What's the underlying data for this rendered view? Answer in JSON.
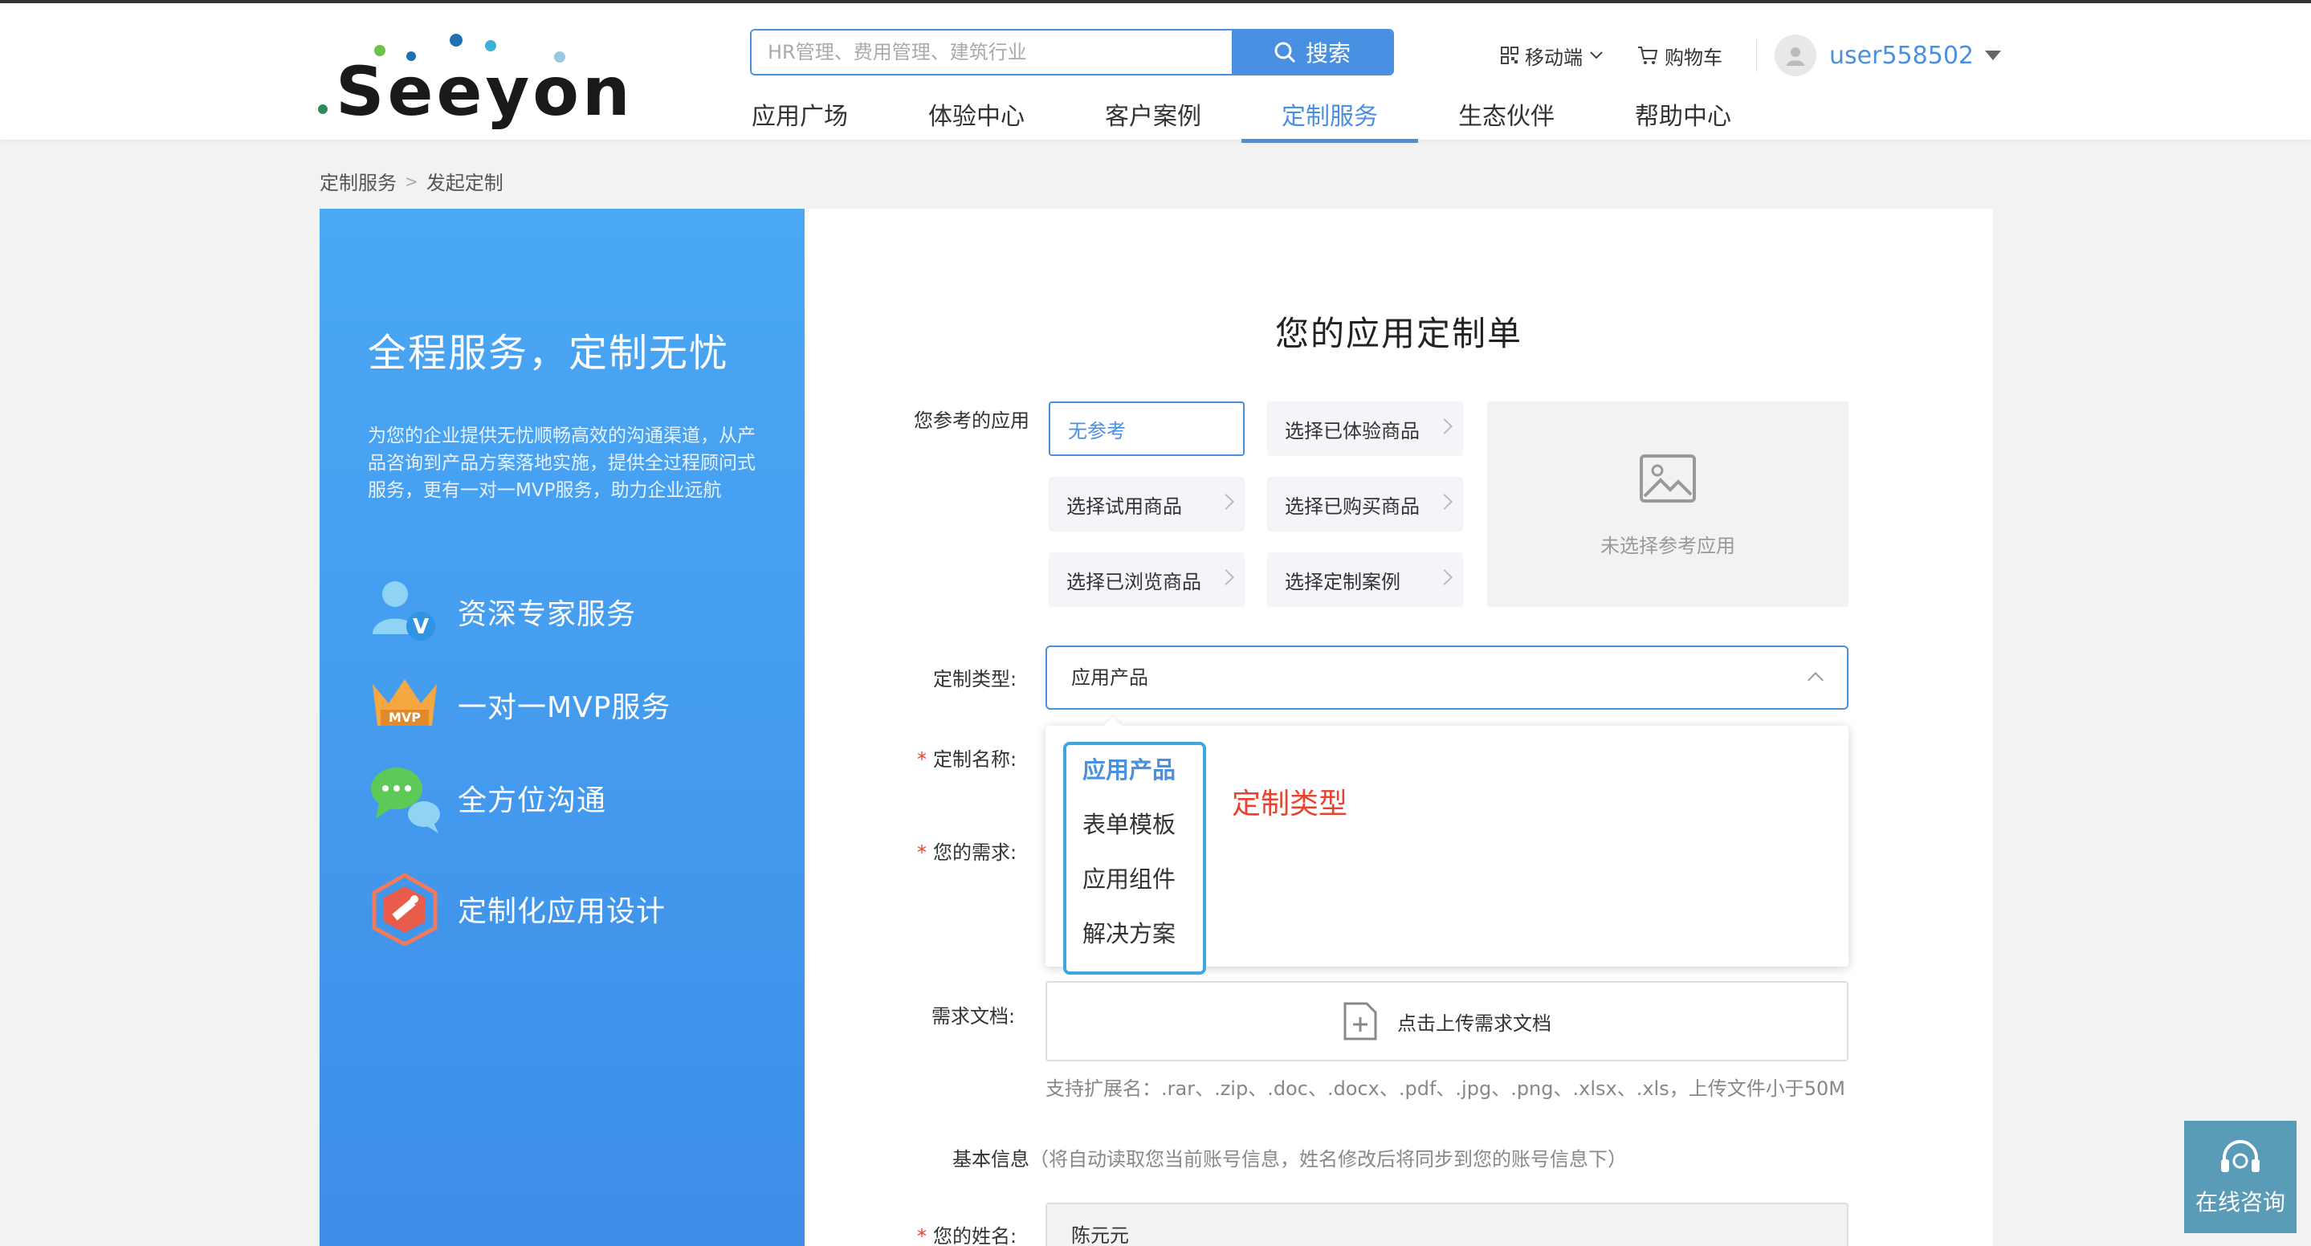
{
  "header": {
    "logo_text": "Seeyon",
    "search": {
      "placeholder": "HR管理、费用管理、建筑行业",
      "button_label": "搜索"
    },
    "nav": [
      "应用广场",
      "体验中心",
      "客户案例",
      "定制服务",
      "生态伙伴",
      "帮助中心"
    ],
    "nav_active": "定制服务",
    "mobile_label": "移动端",
    "cart_label": "购物车",
    "username": "user558502"
  },
  "breadcrumb": {
    "parent": "定制服务",
    "separator": ">",
    "current": "发起定制"
  },
  "left_panel": {
    "title": "全程服务，定制无忧",
    "description": "为您的企业提供无忧顺畅高效的沟通渠道，从产品咨询到产品方案落地实施，提供全过程顾问式服务，更有一对一MVP服务，助力企业远航",
    "features": [
      {
        "icon": "expert-icon",
        "label": "资深专家服务"
      },
      {
        "icon": "mvp-crown-icon",
        "label": "一对一MVP服务"
      },
      {
        "icon": "chat-icon",
        "label": "全方位沟通"
      },
      {
        "icon": "design-icon",
        "label": "定制化应用设计"
      }
    ],
    "mvp_badge": "MVP",
    "v_badge": "V"
  },
  "form": {
    "title": "您的应用定制单",
    "reference": {
      "label": "您参考的应用",
      "buttons": [
        "无参考",
        "选择已体验商品",
        "选择试用商品",
        "选择已购买商品",
        "选择已浏览商品",
        "选择定制案例"
      ],
      "selected": "无参考",
      "preview_text": "未选择参考应用"
    },
    "type": {
      "label": "定制类型:",
      "value": "应用产品",
      "options": [
        "应用产品",
        "表单模板",
        "应用组件",
        "解决方案"
      ],
      "callout": "定制类型"
    },
    "name_label": "定制名称:",
    "need_label": "您的需求:",
    "doc": {
      "label": "需求文档:",
      "upload_text": "点击上传需求文档",
      "hint": "支持扩展名：.rar、.zip、.doc、.docx、.pdf、.jpg、.png、.xlsx、.xls，上传文件小于50M"
    },
    "basic_info": {
      "label": "基本信息",
      "note": "（将自动读取您当前账号信息，姓名修改后将同步到您的账号信息下）"
    },
    "your_name": {
      "label": "您的姓名:",
      "value": "陈元元"
    },
    "required_mark": "*"
  },
  "consult": {
    "label": "在线咨询"
  },
  "colors": {
    "primary": "#4a90e2",
    "panel": "#4aa8f5",
    "required": "#e8432f",
    "consult": "#5a9bb8"
  }
}
